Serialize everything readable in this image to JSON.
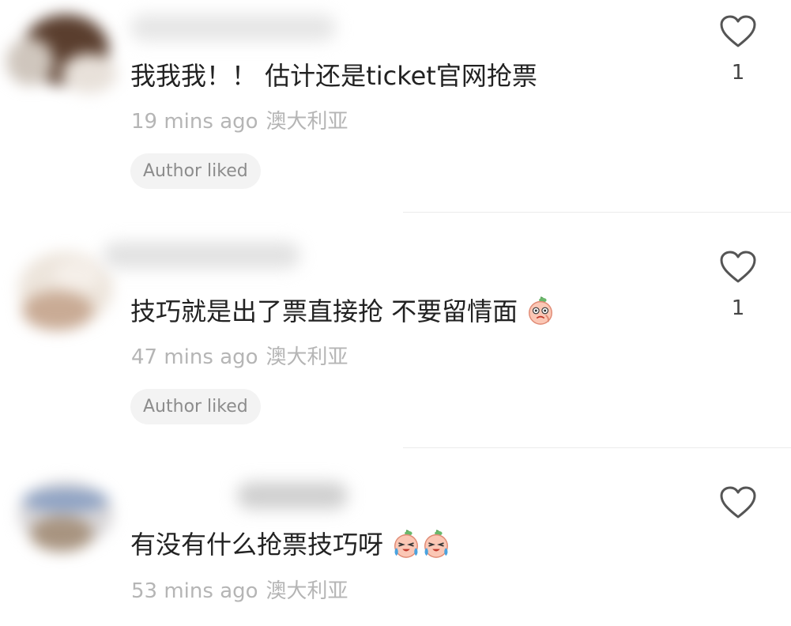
{
  "comments": [
    {
      "text": "我我我！！ 估计还是ticket官网抢票",
      "time": "19 mins ago",
      "location": "澳大利亚",
      "badge": "Author liked",
      "likes": "1",
      "emojis": []
    },
    {
      "text": "技巧就是出了票直接抢  不要留情面",
      "time": "47 mins ago",
      "location": "澳大利亚",
      "badge": "Author liked",
      "likes": "1",
      "emojis": [
        "embarrassed-face-emoji"
      ]
    },
    {
      "text": "有没有什么抢票技巧呀",
      "time": "53 mins ago",
      "location": "澳大利亚",
      "likes": "",
      "emojis": [
        "crying-face-emoji",
        "crying-face-emoji"
      ]
    }
  ],
  "icons": {
    "like": "heart-outline-icon"
  },
  "colors": {
    "text": "#222222",
    "meta": "#b5b5b5",
    "badge_bg": "#f3f3f3",
    "badge_text": "#8c8c8c"
  }
}
